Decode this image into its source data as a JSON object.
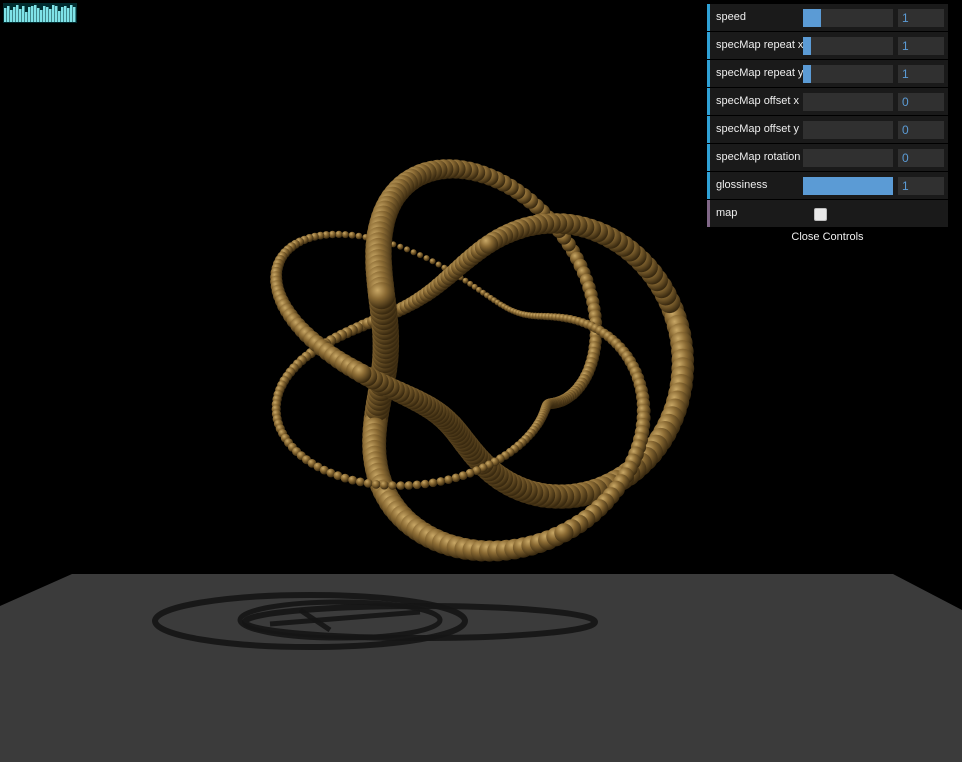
{
  "gui": {
    "controllers": [
      {
        "label": "speed",
        "value": "1",
        "fill": 0.2
      },
      {
        "label": "specMap repeat x",
        "value": "1",
        "fill": 0.1
      },
      {
        "label": "specMap repeat y",
        "value": "1",
        "fill": 0.1
      },
      {
        "label": "specMap offset x",
        "value": "0",
        "fill": 0.0
      },
      {
        "label": "specMap offset y",
        "value": "0",
        "fill": 0.0
      },
      {
        "label": "specMap rotation",
        "value": "0",
        "fill": 0.0
      },
      {
        "label": "glossiness",
        "value": "1",
        "fill": 1.0
      }
    ],
    "map_label": "map",
    "map_checked": false,
    "close_label": "Close Controls"
  },
  "colors": {
    "background": "#000000",
    "floor": "#3a3a3a",
    "knot": "#8a6a34",
    "accent": "#5b9bd5",
    "stats": "#7fe3e8"
  }
}
